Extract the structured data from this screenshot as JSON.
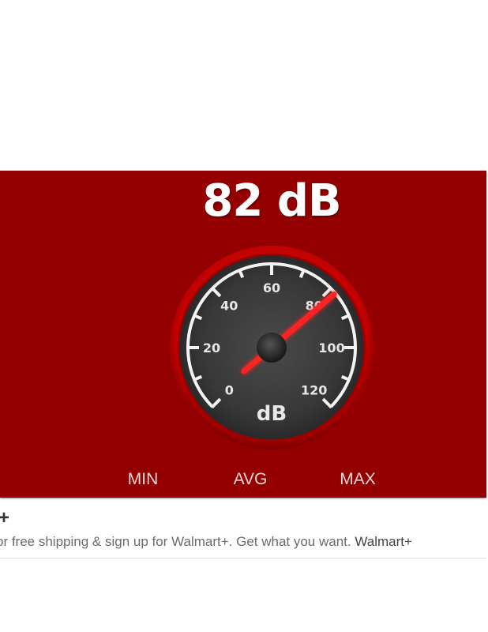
{
  "meter": {
    "reading": "82 dB",
    "value_db": 82,
    "unit_label": "dB",
    "scale_labels": [
      "0",
      "20",
      "40",
      "60",
      "80",
      "100",
      "120"
    ],
    "scale_min": 0,
    "scale_max": 120
  },
  "stats": {
    "min_label": "MIN",
    "avg_label": "AVG",
    "max_label": "MAX"
  },
  "ad": {
    "plus_glyph": "+",
    "text": "or free shipping & sign up for Walmart+. Get what you want. ",
    "brand": "Walmart+"
  },
  "colors": {
    "panel_bg": "#940000",
    "needle": "#ff1a1a",
    "bezel": "#c00000"
  }
}
